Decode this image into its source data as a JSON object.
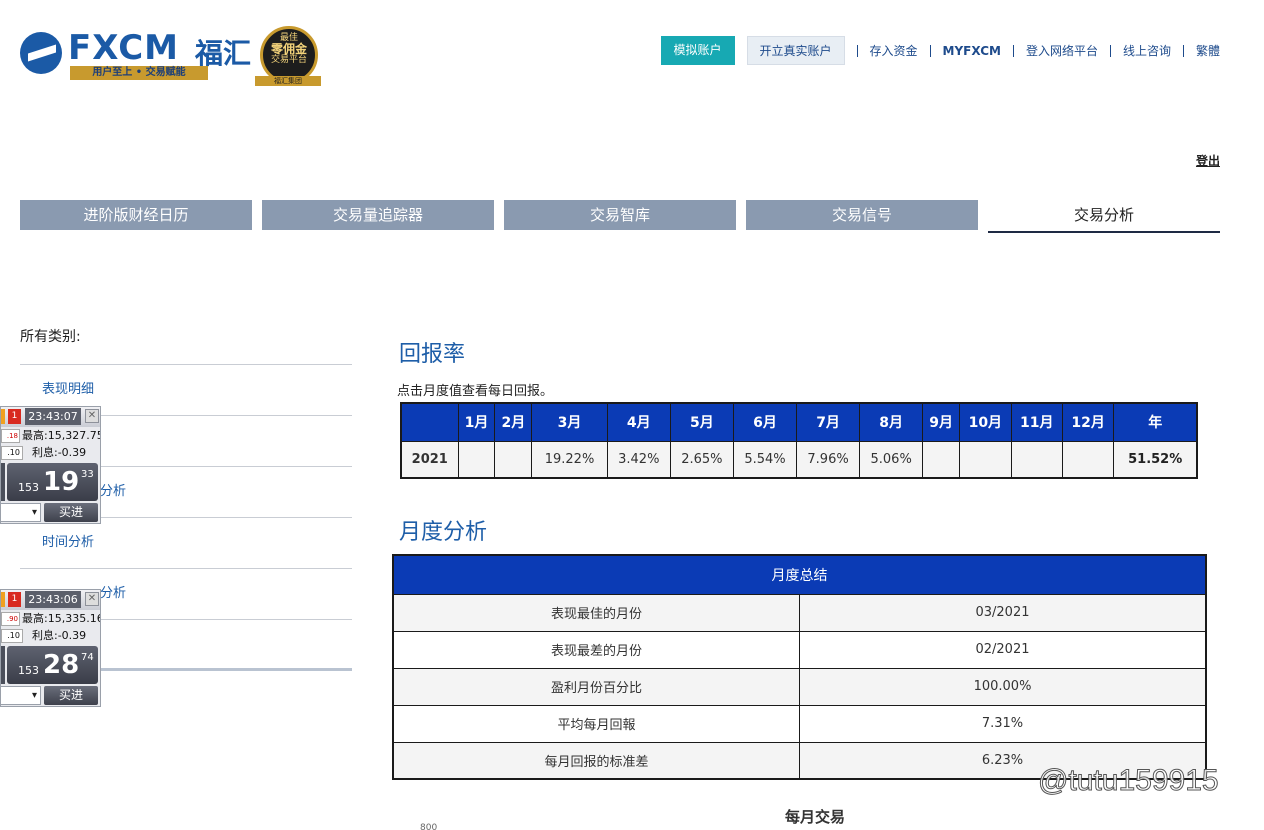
{
  "brand": {
    "name": "FXCM",
    "name_cn": "福汇",
    "slogan": "用户至上 • 交易赋能",
    "badge_top": "最佳",
    "badge_main": "零佣金",
    "badge_sub": "交易平台",
    "badge_ribbon": "福汇集团",
    "colors": {
      "primary": "#1b5aa6",
      "gold": "#c89a2e",
      "teal": "#17a9b3",
      "table_header": "#0b3bb5"
    }
  },
  "topnav": {
    "demo_label": "模拟账户",
    "real_label": "开立真实账户",
    "links": [
      "存入资金",
      "MYFXCM",
      "登入网络平台",
      "线上咨询",
      "繁體"
    ]
  },
  "logout_label": "登出",
  "tabs": [
    "进阶版财经日历",
    "交易量追踪器",
    "交易智库",
    "交易信号",
    "交易分析"
  ],
  "sidebar": {
    "title": "所有类别:",
    "items": [
      "表现明细",
      "",
      "分析",
      "时间分析",
      "分析",
      ""
    ]
  },
  "tickers": [
    {
      "time": "23:43:07",
      "high": "最高:15,327.75",
      "interest": "利息:-0.39",
      "box1": ".18",
      "box2": ".10",
      "price_small": "153",
      "price_big": "19",
      "price_sup": "33",
      "buy": "买进",
      "alert": "1",
      "close": "✕"
    },
    {
      "time": "23:43:06",
      "high": "最高:15,335.16",
      "interest": "利息:-0.39",
      "box1": ".90",
      "box2": ".10",
      "price_small": "153",
      "price_big": "28",
      "price_sup": "74",
      "buy": "买进",
      "alert": "1",
      "close": "✕"
    }
  ],
  "returns": {
    "heading": "回报率",
    "hint": "点击月度值查看每日回报。",
    "headers": [
      "",
      "1月",
      "2月",
      "3月",
      "4月",
      "5月",
      "6月",
      "7月",
      "8月",
      "9月",
      "10月",
      "11月",
      "12月",
      "年"
    ],
    "row": [
      "2021",
      "",
      "",
      "19.22%",
      "3.42%",
      "2.65%",
      "5.54%",
      "7.96%",
      "5.06%",
      "",
      "",
      "",
      "",
      "51.52%"
    ]
  },
  "monthly": {
    "heading": "月度分析",
    "table_header": "月度总结",
    "rows": [
      [
        "表现最佳的月份",
        "03/2021"
      ],
      [
        "表现最差的月份",
        "02/2021"
      ],
      [
        "盈利月份百分比",
        "100.00%"
      ],
      [
        "平均每月回報",
        "7.31%"
      ],
      [
        "每月回报的标准差",
        "6.23%"
      ]
    ]
  },
  "chart": {
    "title": "每月交易",
    "first_tick": "800"
  },
  "watermark": "@tutu159915"
}
